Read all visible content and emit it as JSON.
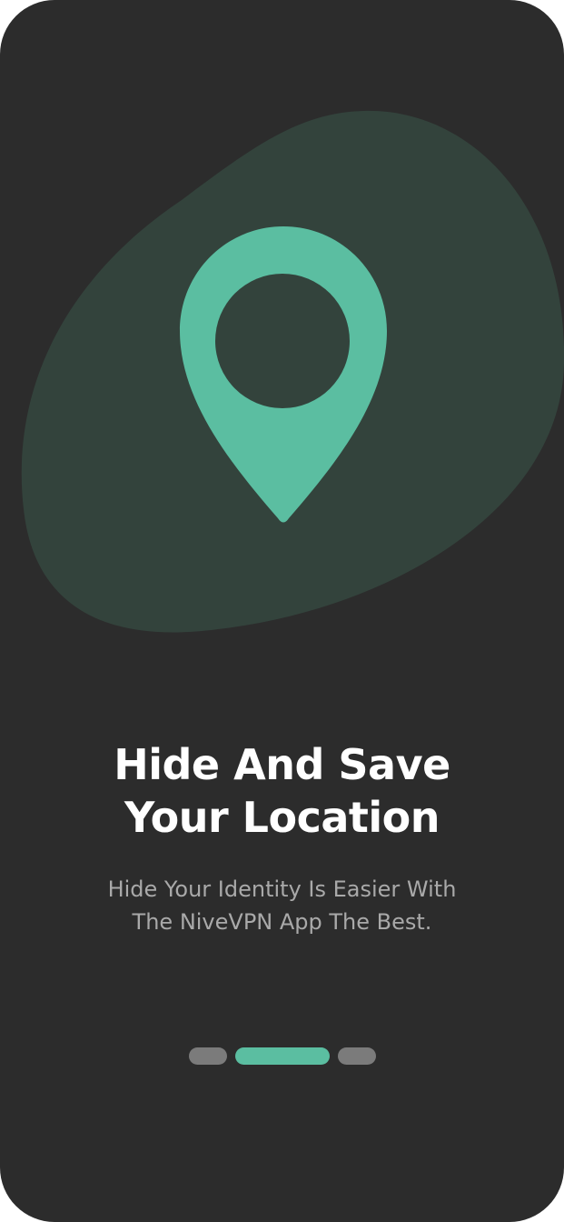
{
  "theme": {
    "background": "#2c2c2c",
    "blob": "#33433c",
    "accent": "#5bbea1",
    "title_color": "#ffffff",
    "subtitle_color": "#a9a9a9",
    "indicator_inactive": "#7b7b7b"
  },
  "hero": {
    "icon": "location-pin-icon"
  },
  "onboarding": {
    "title_line1": "Hide And Save",
    "title_line2": "Your Location",
    "subtitle_line1": "Hide Your Identity Is Easier With",
    "subtitle_line2": "The NiveVPN App The Best."
  },
  "pager": {
    "total": 3,
    "active_index": 1
  }
}
